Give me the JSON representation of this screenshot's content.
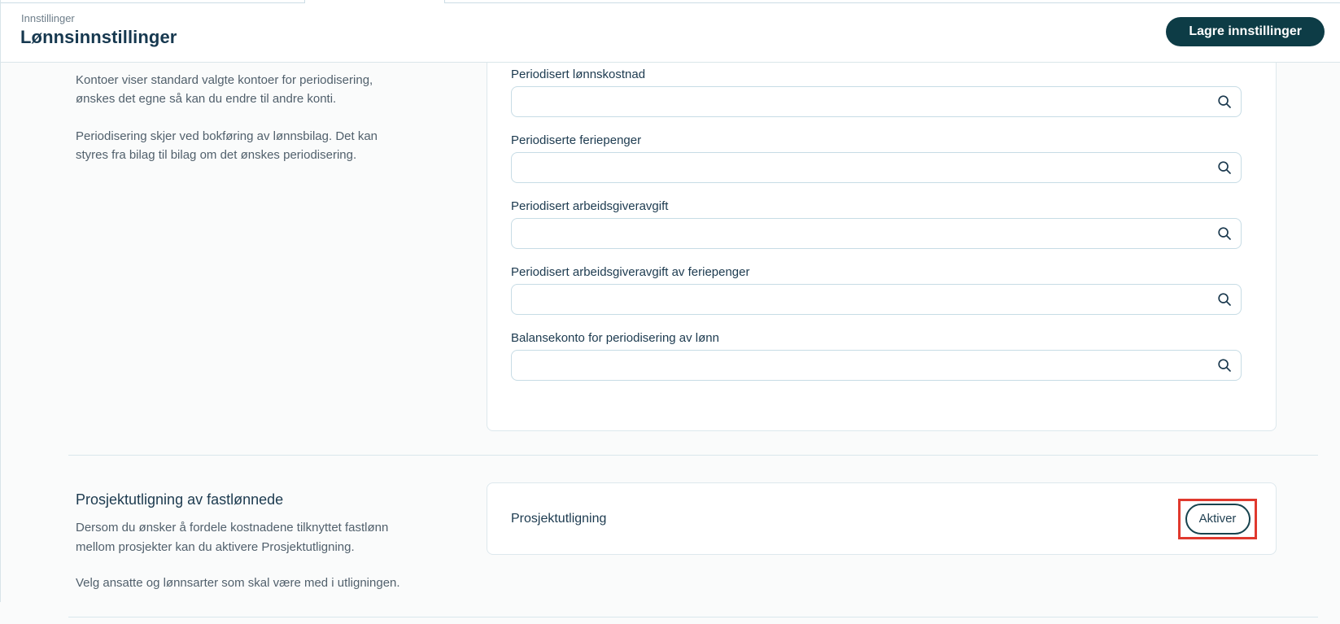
{
  "page": {
    "breadcrumb": "Innstillinger",
    "title": "Lønnsinnstillinger",
    "save_button_label": "Lagre innstillinger"
  },
  "accounts_section": {
    "description_paragraphs": [
      "Kontoer viser standard valgte kontoer for periodisering,\nønskes det egne så kan du endre til andre konti.",
      "Periodisering skjer ved bokføring av lønnsbilag. Det kan\nstyres fra bilag til bilag om det ønskes periodisering."
    ],
    "fields": [
      {
        "label": "Periodisert lønnskostnad",
        "value": "",
        "icon": "search-icon"
      },
      {
        "label": "Periodiserte feriepenger",
        "value": "",
        "icon": "search-icon"
      },
      {
        "label": "Periodisert arbeidsgiveravgift",
        "value": "",
        "icon": "search-icon"
      },
      {
        "label": "Periodisert arbeidsgiveravgift av feriepenger",
        "value": "",
        "icon": "search-icon"
      },
      {
        "label": "Balansekonto for periodisering av lønn",
        "value": "",
        "icon": "search-icon"
      }
    ]
  },
  "project_section": {
    "heading": "Prosjektutligning av fastlønnede",
    "description_paragraphs": [
      "Dersom du ønsker å fordele kostnadene tilknyttet fastlønn\nmellom prosjekter kan du aktivere Prosjektutligning.",
      "Velg ansatte og lønnsarter som skal være med i utligningen."
    ],
    "panel_label": "Prosjektutligning",
    "activate_button_label": "Aktiver"
  },
  "colors": {
    "primary_button_bg": "#0d3c46",
    "heading_text": "#1c3a4f",
    "body_text": "#51606c",
    "card_border": "#dde8ed",
    "input_border": "#c7dce5",
    "divider": "#d9e7ec",
    "highlight_red": "#e0392e",
    "content_bg": "#fafbfb"
  }
}
